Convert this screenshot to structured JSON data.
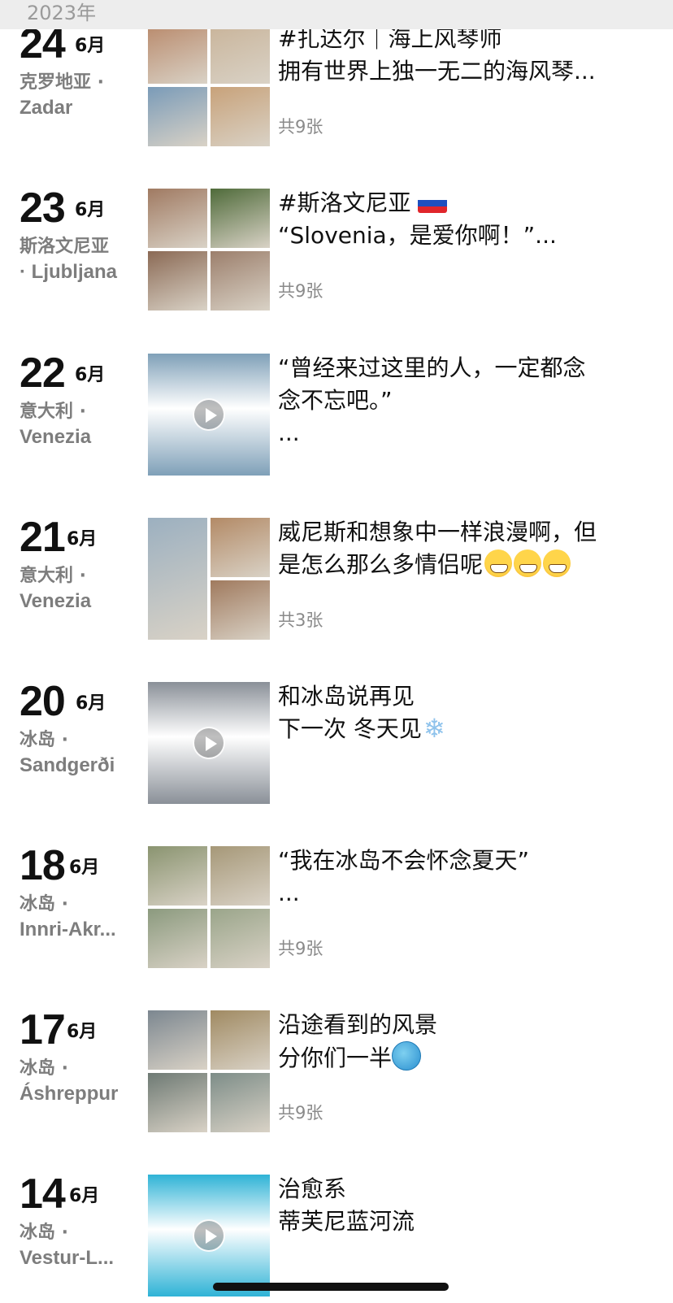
{
  "header": {
    "year": "2023年"
  },
  "posts": [
    {
      "day": "24",
      "month": "6月",
      "loc1": "克罗地亚 ·",
      "loc2": "Zadar",
      "line1": "#扎达尔｜海上风琴师",
      "line2": "拥有世界上独一无二的海风琴...",
      "line3": "",
      "count": "共9张",
      "media": "grid",
      "colors": [
        "#b98a6c",
        "#c9b49a",
        "#7a9bb8",
        "#c8a27a"
      ]
    },
    {
      "day": "23",
      "month": "6月",
      "loc1": "斯洛文尼亚",
      "loc2": "· Ljubljana",
      "line1": "#斯洛文尼亚",
      "line2": "“Slovenia，是爱你啊！”...",
      "line3": "",
      "count": "共9张",
      "media": "grid",
      "colors": [
        "#a07a62",
        "#4f6b3a",
        "#8b6a55",
        "#9c7f6c"
      ],
      "flag": true
    },
    {
      "day": "22",
      "month": "6月",
      "loc1": "意大利 ·",
      "loc2": "Venezia",
      "line1": "“曾经来过这里的人，一定都念",
      "line2": "念不忘吧。”",
      "line3": "...",
      "count": "",
      "media": "video",
      "colors": [
        "#7fa0b8"
      ]
    },
    {
      "day": "21",
      "month": "6月",
      "loc1": "意大利 ·",
      "loc2": "Venezia",
      "line1": "威尼斯和想象中一样浪漫啊，但",
      "line2": "是怎么那么多情侣呢",
      "line3": "",
      "count": "共3张",
      "media": "grid3",
      "colors": [
        "#9cb0c0",
        "#b38a66",
        "#a07a5e"
      ],
      "emoji": "grin3"
    },
    {
      "day": "20",
      "month": "6月",
      "loc1": "冰岛 ·",
      "loc2": "Sandgerði",
      "line1": "和冰岛说再见",
      "line2": "下一次 冬天见",
      "line3": "",
      "count": "",
      "media": "video",
      "colors": [
        "#8a9098"
      ],
      "emoji": "snow"
    },
    {
      "day": "18",
      "month": "6月",
      "loc1": "冰岛 ·",
      "loc2": "Innri-Akr...",
      "line1": "“我在冰岛不会怀念夏天”",
      "line2": "...",
      "line3": "",
      "count": "共9张",
      "media": "grid",
      "colors": [
        "#8a9470",
        "#a69878",
        "#8b9a7e",
        "#9aa58a"
      ]
    },
    {
      "day": "17",
      "month": "6月",
      "loc1": "冰岛 ·",
      "loc2": "Áshreppur",
      "line1": "沿途看到的风景",
      "line2": "分你们一半",
      "line3": "",
      "count": "共9张",
      "media": "grid",
      "colors": [
        "#7c8790",
        "#a08a62",
        "#6e7a74",
        "#7d8d88"
      ],
      "emoji": "globe"
    },
    {
      "day": "14",
      "month": "6月",
      "loc1": "冰岛 ·",
      "loc2": "Vestur-L...",
      "line1": "治愈系",
      "line2": "蒂芙尼蓝河流",
      "line3": "",
      "count": "",
      "media": "video",
      "colors": [
        "#2fb3d6"
      ]
    }
  ]
}
